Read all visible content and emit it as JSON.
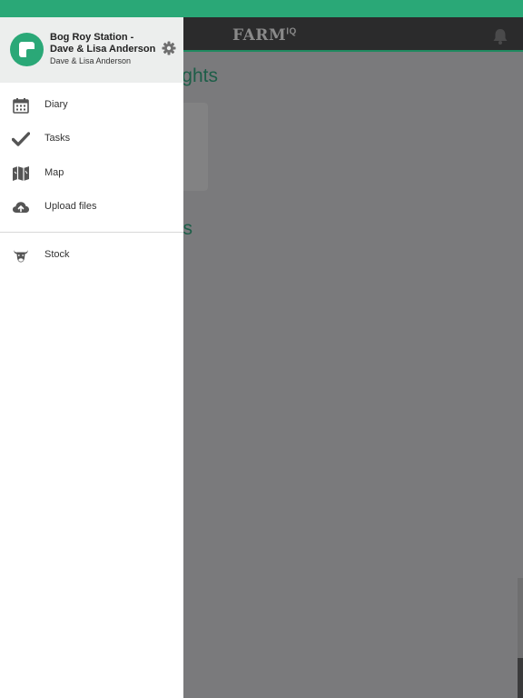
{
  "app": {
    "logo_text": "FARM",
    "logo_sup": "IQ",
    "bg_heading_1": "ghts",
    "bg_heading_2": "s"
  },
  "drawer": {
    "farm_name": "Bog Roy Station - Dave & Lisa Anderson",
    "owner_name": "Dave & Lisa Anderson",
    "menu": [
      {
        "label": "Diary",
        "icon": "calendar-icon"
      },
      {
        "label": "Tasks",
        "icon": "checkmark-icon"
      },
      {
        "label": "Map",
        "icon": "map-icon"
      },
      {
        "label": "Upload files",
        "icon": "cloud-upload-icon"
      },
      {
        "label": "Stock",
        "icon": "cow-icon"
      }
    ]
  },
  "colors": {
    "accent": "#2aa877",
    "header_dark": "#2b2b2c",
    "overlay": "#7a7a7c"
  }
}
